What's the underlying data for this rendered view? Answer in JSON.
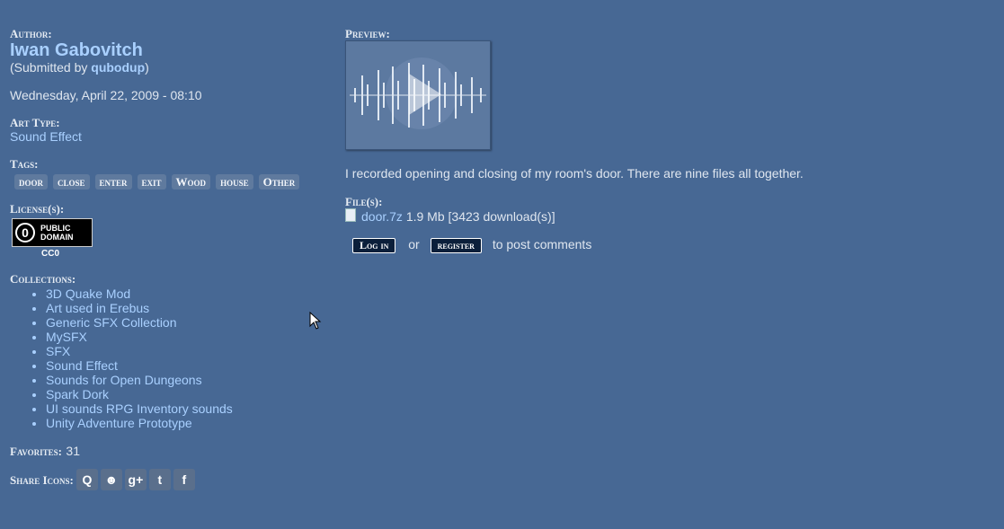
{
  "author": {
    "label": "Author:",
    "name": "Iwan Gabovitch",
    "submitted_prefix": "(Submitted by ",
    "submitted_by": "qubodup",
    "submitted_suffix": ")",
    "date": "Wednesday, April 22, 2009 - 08:10"
  },
  "art_type": {
    "label": "Art Type:",
    "value": "Sound Effect"
  },
  "tags": {
    "label": "Tags:",
    "items": [
      "door",
      "close",
      "enter",
      "exit",
      "Wood",
      "house",
      "Other"
    ]
  },
  "license": {
    "label": "License(s):",
    "badge_line1": "PUBLIC",
    "badge_line2": "DOMAIN",
    "badge_symbol": "0",
    "name": "CC0"
  },
  "collections": {
    "label": "Collections:",
    "items": [
      "3D Quake Mod",
      "Art used in Erebus",
      "Generic SFX Collection",
      "MySFX",
      "SFX",
      "Sound Effect",
      "Sounds for Open Dungeons",
      "Spark Dork",
      "UI sounds RPG Inventory sounds",
      "Unity Adventure Prototype"
    ]
  },
  "favorites": {
    "label": "Favorites:",
    "count": "31"
  },
  "share": {
    "label": "Share Icons:",
    "icons": [
      "q-icon",
      "reddit-icon",
      "google-plus-icon",
      "twitter-icon",
      "facebook-icon"
    ],
    "glyphs": [
      "Q",
      "☻",
      "g+",
      "t",
      "f"
    ]
  },
  "preview": {
    "label": "Preview:"
  },
  "description": "I recorded opening and closing of my room's door. There are nine files all together.",
  "files": {
    "label": "File(s):",
    "name": "door.7z",
    "meta": " 1.9 Mb [3423 download(s)]"
  },
  "comments": {
    "login": "Log in",
    "or": "or",
    "register": "register",
    "suffix": "to post comments"
  }
}
